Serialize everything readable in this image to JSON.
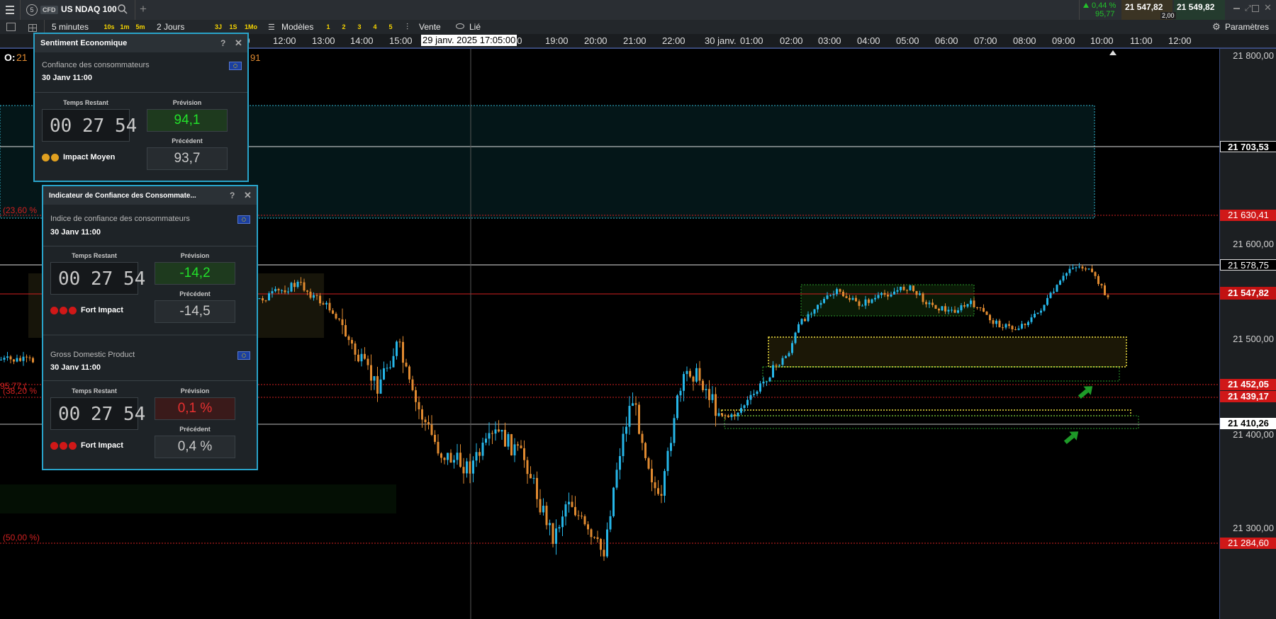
{
  "topbar": {
    "instrument_number": "5",
    "instrument_type": "CFD",
    "instrument_name": "US NDAQ 100",
    "change_pct": "0,44 %",
    "change_pts": "95,77",
    "sell_price": "21 547,82",
    "buy_price": "21 549,82",
    "spread": "2,00"
  },
  "toolbar": {
    "interval": "5 minutes",
    "quick_intervals": [
      "10s",
      "1m",
      "5m"
    ],
    "range": "2 Jours",
    "quick_ranges": [
      "3J",
      "1S",
      "1Mo"
    ],
    "templates_label": "Modèles",
    "template_slots": [
      "1",
      "2",
      "3",
      "4",
      "5"
    ],
    "sell_label": "Vente",
    "linked_label": "Lié",
    "settings_label": "Paramètres"
  },
  "timeline": {
    "labels": [
      "00",
      "12:00",
      "13:00",
      "14:00",
      "15:00",
      "00",
      "19:00",
      "20:00",
      "21:00",
      "22:00",
      "30 janv.",
      "01:00",
      "02:00",
      "03:00",
      "04:00",
      "05:00",
      "06:00",
      "07:00",
      "08:00",
      "09:00",
      "10:00",
      "11:00",
      "12:00"
    ],
    "cursor_label": "29 janv. 2025 17:05:00"
  },
  "chart_overlay": {
    "ohlc_prefix": "O:",
    "ohlc_partial": "21",
    "ohlc_tail": "91",
    "fib_23": "(23,60 %",
    "fib_38": "(38,20 %",
    "fib_38_overlap": "95,77 (",
    "fib_50": "(50,00 %)"
  },
  "price_axis": {
    "ticks": [
      "21 800,00",
      "21 600,00",
      "21 500,00",
      "21 400,00",
      "21 300,00"
    ],
    "tag_white_top": "21 703,53",
    "tag_red_1": "21 630,41",
    "tag_white_2": "21 578,75",
    "tag_current": "21 547,82",
    "tag_red_2": "21 452,05",
    "tag_red_3": "21 439,17",
    "tag_white_3": "21 410,26",
    "tag_red_4": "21 284,60"
  },
  "panels": [
    {
      "title": "Sentiment Economique",
      "event": "Confiance des consommateurs",
      "date": "30 Janv 11:00",
      "remaining_label": "Temps Restant",
      "hh": "00",
      "mm": "27",
      "ss": "54",
      "forecast_label": "Prévision",
      "forecast": "94,1",
      "previous_label": "Précédent",
      "previous": "93,7",
      "impact": "Impact Moyen"
    },
    {
      "title": "Indicateur de Confiance des Consommate...",
      "event": "Indice de confiance des consommateurs",
      "date": "30 Janv 11:00",
      "remaining_label": "Temps Restant",
      "hh": "00",
      "mm": "27",
      "ss": "54",
      "forecast_label": "Prévision",
      "forecast": "-14,2",
      "previous_label": "Précédent",
      "previous": "-14,5",
      "impact": "Fort Impact"
    },
    {
      "event": "Gross Domestic Product",
      "date": "30 Janv 11:00",
      "remaining_label": "Temps Restant",
      "hh": "00",
      "mm": "27",
      "ss": "54",
      "forecast_label": "Prévision",
      "forecast": "0,1 %",
      "previous_label": "Précédent",
      "previous": "0,4 %",
      "impact": "Fort Impact"
    }
  ],
  "colors": {
    "up_candle": "#26b6e8",
    "down_candle": "#e08a30",
    "red_line": "#e02020",
    "positive": "#22c02a",
    "negative": "#e03030",
    "panel_border": "#29a3c9"
  }
}
